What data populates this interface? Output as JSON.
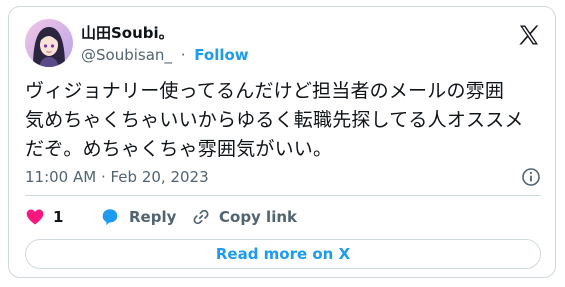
{
  "author": {
    "display_name": "山田Soubi。",
    "handle": "@Soubisan_",
    "separator": "·",
    "follow_label": "Follow"
  },
  "tweet": {
    "text": "ヴィジョナリー使ってるんだけど担当者のメールの雰囲\n気めちゃくちゃいいからゆるく転職先探してる人オススメ\nだぞ。めちゃくちゃ雰囲気がいい。",
    "timestamp": "11:00 AM · Feb 20, 2023"
  },
  "actions": {
    "like_count": "1",
    "reply_label": "Reply",
    "copy_link_label": "Copy link"
  },
  "read_more_label": "Read more on X",
  "colors": {
    "accent": "#1d9bf0",
    "like": "#f91880",
    "secondary_text": "#536471",
    "border": "#cfd9de"
  },
  "icons": [
    "avatar",
    "x-logo-icon",
    "info-icon",
    "heart-icon",
    "reply-bubble-icon",
    "link-icon"
  ]
}
